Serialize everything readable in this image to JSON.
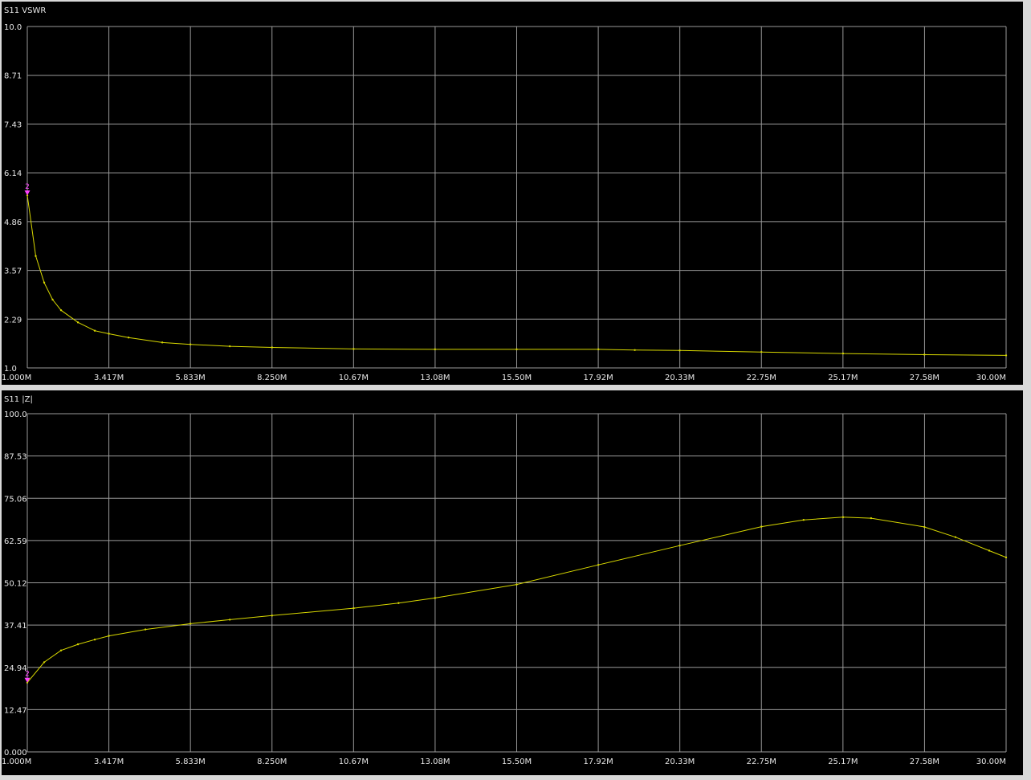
{
  "colors": {
    "background": "#000000",
    "grid": "#9a9a9a",
    "trace": "#d8d800",
    "marker": "#ff40ff",
    "text": "#e6e6e6"
  },
  "chart_data": [
    {
      "type": "line",
      "title": "S11 VSWR",
      "xlabel": "",
      "ylabel": "",
      "x_ticks": [
        "1.000M",
        "3.417M",
        "5.833M",
        "8.250M",
        "10.67M",
        "13.08M",
        "15.50M",
        "17.92M",
        "20.33M",
        "22.75M",
        "25.17M",
        "27.58M",
        "30.00M"
      ],
      "y_ticks": [
        "10.0",
        "8.71",
        "7.43",
        "6.14",
        "4.86",
        "3.57",
        "2.29",
        "1.0"
      ],
      "xlim": [
        1.0,
        30.0
      ],
      "ylim": [
        1.0,
        10.0
      ],
      "grid": true,
      "marker": {
        "label": "2",
        "x": 1.0,
        "y": 5.55
      },
      "series": [
        {
          "x": [
            1.0,
            1.25,
            1.5,
            1.75,
            2.0,
            2.5,
            3.0,
            3.417,
            4.0,
            5.0,
            5.833,
            7.0,
            8.25,
            10.67,
            13.08,
            15.5,
            17.92,
            19.0,
            20.33,
            22.75,
            25.17,
            27.58,
            30.0
          ],
          "values": [
            5.55,
            3.95,
            3.25,
            2.8,
            2.52,
            2.2,
            1.98,
            1.9,
            1.8,
            1.67,
            1.62,
            1.57,
            1.54,
            1.5,
            1.49,
            1.49,
            1.49,
            1.47,
            1.46,
            1.42,
            1.38,
            1.35,
            1.33
          ]
        }
      ]
    },
    {
      "type": "line",
      "title": "S11 |Z|",
      "xlabel": "",
      "ylabel": "",
      "x_ticks": [
        "1.000M",
        "3.417M",
        "5.833M",
        "8.250M",
        "10.67M",
        "13.08M",
        "15.50M",
        "17.92M",
        "20.33M",
        "22.75M",
        "25.17M",
        "27.58M",
        "30.00M"
      ],
      "y_ticks": [
        "100.0",
        "87.53",
        "75.06",
        "62.59",
        "50.12",
        "37.41",
        "24.94",
        "12.47",
        "0.000"
      ],
      "xlim": [
        1.0,
        30.0
      ],
      "ylim": [
        0.0,
        100.0
      ],
      "grid": true,
      "marker": {
        "label": "2",
        "x": 1.0,
        "y": 20.5
      },
      "series": [
        {
          "x": [
            1.0,
            1.5,
            2.0,
            2.5,
            3.0,
            3.417,
            4.5,
            5.833,
            7.0,
            8.25,
            10.67,
            12.0,
            13.08,
            15.5,
            17.92,
            20.33,
            22.75,
            24.0,
            25.17,
            26.0,
            27.58,
            28.5,
            29.5,
            30.0
          ],
          "values": [
            20.5,
            26.5,
            30.0,
            31.8,
            33.2,
            34.3,
            36.2,
            37.9,
            39.1,
            40.3,
            42.5,
            44.0,
            45.5,
            49.5,
            55.3,
            61.0,
            66.6,
            68.6,
            69.4,
            69.1,
            66.5,
            63.5,
            59.5,
            57.5
          ]
        }
      ]
    }
  ]
}
